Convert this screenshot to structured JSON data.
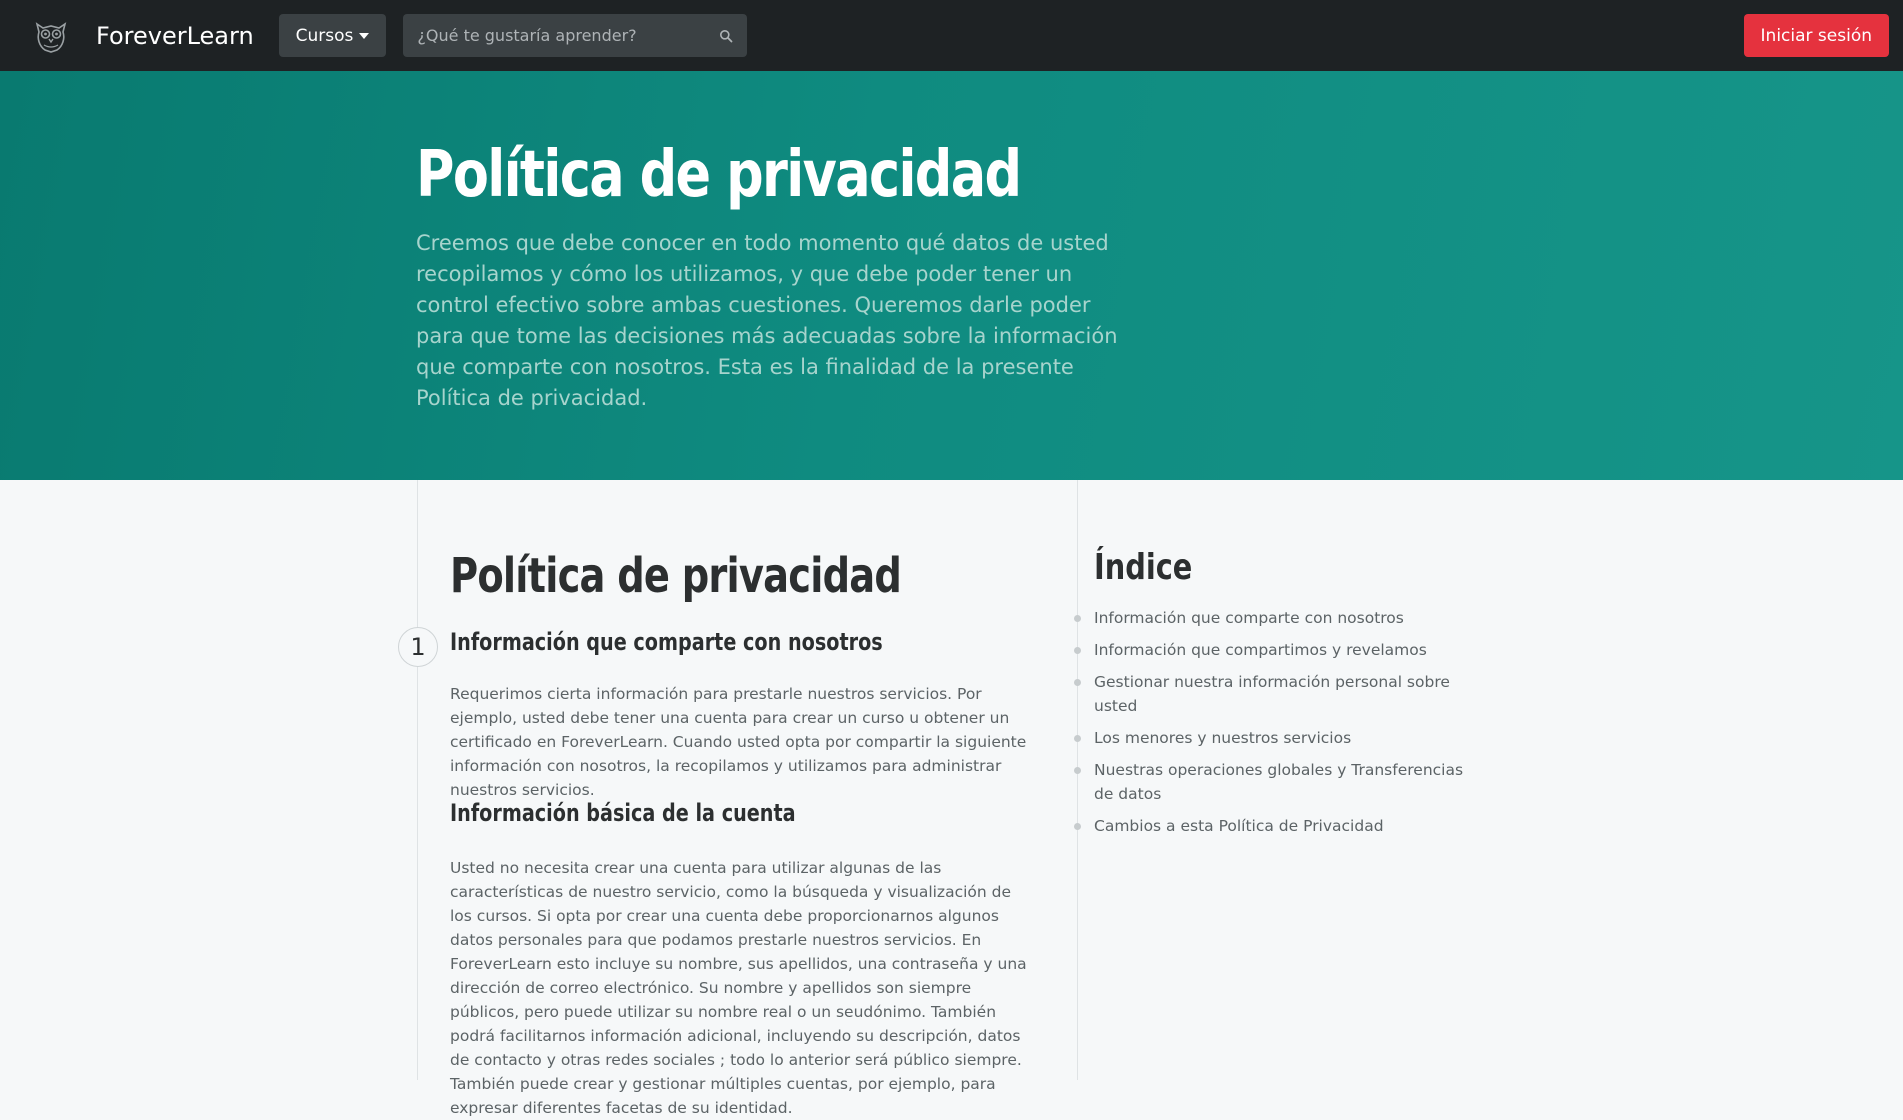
{
  "header": {
    "brand_name": "ForeverLearn",
    "brand_icon": "owl-logo-icon",
    "courses_label": "Cursos",
    "search_placeholder": "¿Qué te gustaría aprender?",
    "login_label": "Iniciar sesión"
  },
  "hero": {
    "title": "Política de privacidad",
    "text": "Creemos que debe conocer en todo momento qué datos de usted recopilamos y cómo los utilizamos, y que debe poder tener un control efectivo sobre ambas cuestiones. Queremos darle poder para que tome las decisiones más adecuadas sobre la información que comparte con nosotros. Esta es la finalidad de la presente Política de privacidad."
  },
  "main": {
    "title": "Política de privacidad",
    "step_number": "1",
    "section1_title": "Información que comparte con nosotros",
    "section1_text": "Requerimos cierta información para prestarle nuestros servicios. Por ejemplo, usted debe tener una cuenta para crear un curso u obtener un certificado en ForeverLearn. Cuando usted opta por compartir la siguiente información con nosotros, la recopilamos y utilizamos para administrar nuestros servicios.",
    "section2_title": "Información básica de la cuenta",
    "section2_text": "Usted no necesita crear una cuenta para utilizar algunas de las características de nuestro servicio, como la búsqueda y visualización de los cursos. Si opta por crear una cuenta debe proporcionarnos algunos datos personales para que podamos prestarle nuestros servicios. En ForeverLearn esto incluye su nombre, sus apellidos, una contraseña y una dirección de correo electrónico. Su nombre y apellidos son siempre públicos, pero puede utilizar su nombre real o un seudónimo. También podrá facilitarnos información adicional, incluyendo su descripción, datos de contacto y otras redes sociales ; todo lo anterior será público siempre. También puede crear y gestionar múltiples cuentas, por ejemplo, para expresar diferentes facetas de su identidad."
  },
  "sidebar": {
    "title": "Índice",
    "items": [
      "Información que comparte con nosotros",
      "Información que compartimos y revelamos",
      "Gestionar nuestra información personal sobre usted",
      "Los menores y nuestros servicios",
      "Nuestras operaciones globales y Transferencias de datos",
      "Cambios a esta Política de Privacidad"
    ]
  },
  "colors": {
    "navbar": "#1e2224",
    "hero": "#0f8b80",
    "login_button": "#e5323e",
    "background": "#f6f8f9"
  }
}
